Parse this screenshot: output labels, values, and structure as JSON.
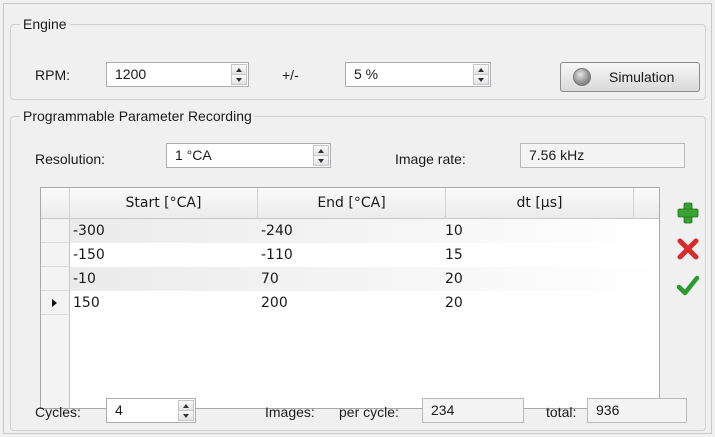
{
  "engine": {
    "legend": "Engine",
    "rpm_label": "RPM:",
    "rpm_value": "1200",
    "tolerance_label": "+/-",
    "tolerance_value": "5 %",
    "simulation_label": "Simulation"
  },
  "recording": {
    "legend": "Programmable Parameter Recording",
    "resolution_label": "Resolution:",
    "resolution_value": "1 °CA",
    "image_rate_label": "Image rate:",
    "image_rate_value": "7.56 kHz",
    "table": {
      "columns": [
        "Start [°CA]",
        "End [°CA]",
        "dt [µs]"
      ],
      "rows": [
        [
          "-300",
          "-240",
          "10"
        ],
        [
          "-150",
          "-110",
          "15"
        ],
        [
          "-10",
          "70",
          "20"
        ],
        [
          "150",
          "200",
          "20"
        ]
      ],
      "current_row": 4
    },
    "cycles_label": "Cycles:",
    "cycles_value": "4",
    "images_label": "Images:",
    "per_cycle_label": "per cycle:",
    "per_cycle_value": "234",
    "total_label": "total:",
    "total_value": "936"
  },
  "icons": {
    "add": "plus-icon",
    "delete": "x-icon",
    "apply": "check-icon"
  },
  "colors": {
    "add": "#3aa132",
    "delete": "#d82a2a",
    "apply": "#2e9a2e"
  }
}
